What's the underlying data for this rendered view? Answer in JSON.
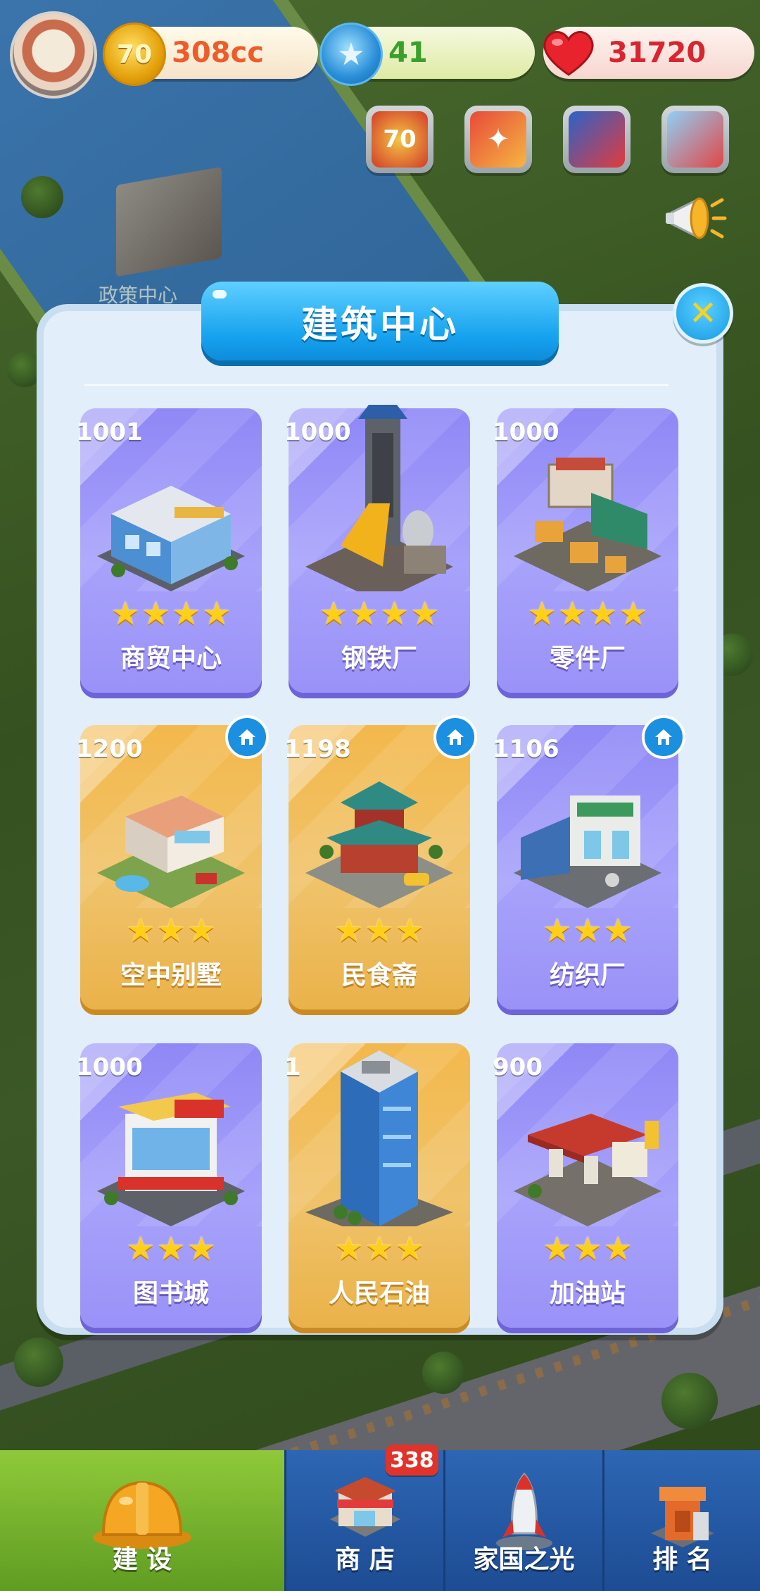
{
  "hud": {
    "coins": "308cc",
    "coin_icon_text": "70",
    "stars": "41",
    "hearts": "31720"
  },
  "background": {
    "label": "政策中心"
  },
  "modal": {
    "title": "建筑中心"
  },
  "buildings": [
    {
      "id": "1001",
      "name": "商贸中心",
      "stars": "★★★★",
      "stars_count": 4,
      "style": "purple",
      "home": false
    },
    {
      "id": "1000",
      "name": "钢铁厂",
      "stars": "★★★★",
      "stars_count": 4,
      "style": "purple",
      "home": false
    },
    {
      "id": "1000",
      "name": "零件厂",
      "stars": "★★★★",
      "stars_count": 4,
      "style": "purple",
      "home": false
    },
    {
      "id": "1200",
      "name": "空中别墅",
      "stars": "★★★",
      "stars_count": 3,
      "style": "gold",
      "home": true
    },
    {
      "id": "1198",
      "name": "民食斋",
      "stars": "★★★",
      "stars_count": 3,
      "style": "gold",
      "home": true
    },
    {
      "id": "1106",
      "name": "纺织厂",
      "stars": "★★★",
      "stars_count": 3,
      "style": "purple",
      "home": true
    },
    {
      "id": "1000",
      "name": "图书城",
      "stars": "★★★",
      "stars_count": 3,
      "style": "purple",
      "home": false
    },
    {
      "id": "1",
      "name": "人民石油",
      "stars": "★★★",
      "stars_count": 3,
      "style": "gold",
      "home": false
    },
    {
      "id": "900",
      "name": "加油站",
      "stars": "★★★",
      "stars_count": 3,
      "style": "purple",
      "home": false
    }
  ],
  "tabs": [
    {
      "label": "建 设",
      "active": true
    },
    {
      "label": "商 店",
      "badge": "338"
    },
    {
      "label": "家国之光"
    },
    {
      "label": "排 名"
    }
  ],
  "colors": {
    "accent_blue": "#16a2ee",
    "card_purple": "#9a92f7",
    "card_gold": "#f0c36a",
    "star_yellow": "#ffcf1a",
    "active_tab": "#8fc93a"
  }
}
